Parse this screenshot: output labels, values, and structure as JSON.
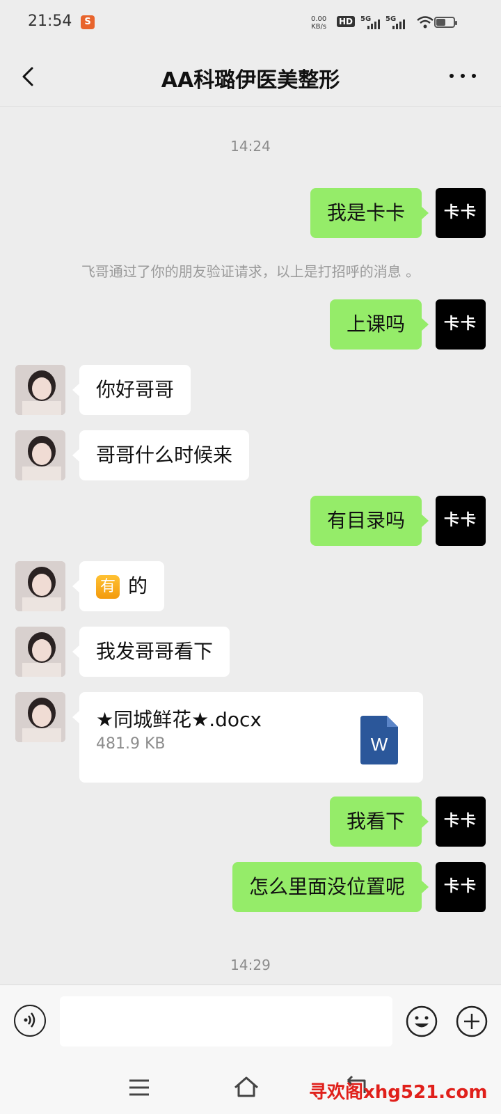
{
  "status_bar": {
    "time": "21:54",
    "net_speed_value": "0.00",
    "net_speed_unit": "KB/s",
    "hd_label": "HD",
    "sim1_label": "5G",
    "sim2_label": "5G",
    "battery_level": 0.55
  },
  "header": {
    "title": "AA科璐伊医美整形"
  },
  "messages": {
    "timestamp_1": "14:24",
    "m1": "我是卡卡",
    "system_notice": "飞哥通过了你的朋友验证请求，以上是打招呼的消息 。",
    "m2": "上课吗",
    "m3": "你好哥哥",
    "m4": "哥哥什么时候来",
    "m5": "有目录吗",
    "m6_badge": "有",
    "m6_text": "的",
    "m7": "我发哥哥看下",
    "file": {
      "name": "★同城鲜花★.docx",
      "size": "481.9 KB",
      "icon_letter": "W"
    },
    "m8": "我看下",
    "m9": "怎么里面没位置呢",
    "timestamp_2": "14:29"
  },
  "self_avatar_text": "卡卡",
  "input": {
    "placeholder": ""
  },
  "watermark": "寻欢阁xhg521.com",
  "colors": {
    "outgoing_bubble": "#95ec69",
    "incoming_bubble": "#ffffff",
    "background": "#ededed",
    "word_blue": "#2b579a"
  }
}
